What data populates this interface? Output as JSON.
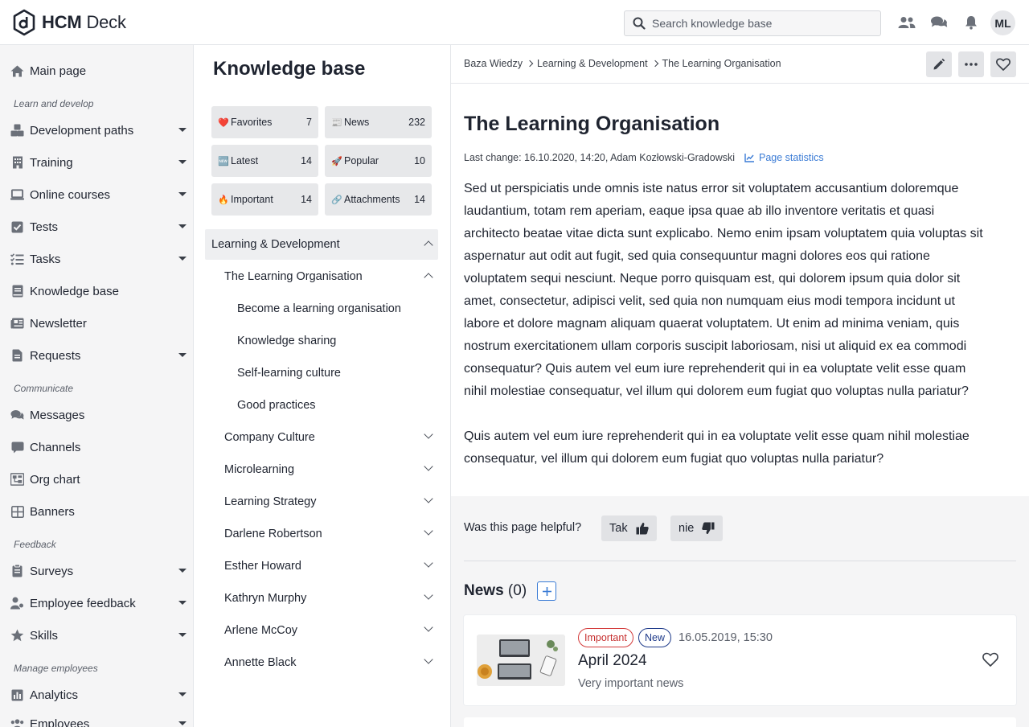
{
  "app": {
    "brand_bold": "HCM",
    "brand_light": "Deck"
  },
  "header": {
    "search_placeholder": "Search knowledge base",
    "user_initials": "ML",
    "icons": [
      "users-icon",
      "chat-icon",
      "bell-icon"
    ]
  },
  "sidebar": {
    "items": [
      {
        "label": "Main page",
        "icon": "home-icon",
        "has_submenu": false
      },
      {
        "label": "Development paths",
        "icon": "cubes-icon",
        "has_submenu": true
      },
      {
        "label": "Training",
        "icon": "building-icon",
        "has_submenu": true
      },
      {
        "label": "Online courses",
        "icon": "laptop-icon",
        "has_submenu": true
      },
      {
        "label": "Tests",
        "icon": "check-square-icon",
        "has_submenu": true
      },
      {
        "label": "Tasks",
        "icon": "tasks-icon",
        "has_submenu": true
      },
      {
        "label": "Knowledge base",
        "icon": "book-icon",
        "has_submenu": false
      },
      {
        "label": "Newsletter",
        "icon": "newspaper-icon",
        "has_submenu": false
      },
      {
        "label": "Requests",
        "icon": "file-icon",
        "has_submenu": true
      },
      {
        "label": "Messages",
        "icon": "comments-icon",
        "has_submenu": false
      },
      {
        "label": "Channels",
        "icon": "comment-icon",
        "has_submenu": false
      },
      {
        "label": "Org chart",
        "icon": "org-chart-icon",
        "has_submenu": false
      },
      {
        "label": "Banners",
        "icon": "grid-icon",
        "has_submenu": false
      },
      {
        "label": "Surveys",
        "icon": "clipboard-icon",
        "has_submenu": true
      },
      {
        "label": "Employee feedback",
        "icon": "user-feedback-icon",
        "has_submenu": true
      },
      {
        "label": "Skills",
        "icon": "star-icon",
        "has_submenu": true
      },
      {
        "label": "Analytics",
        "icon": "chart-icon",
        "has_submenu": true
      },
      {
        "label": "Employees",
        "icon": "users-icon",
        "has_submenu": true
      }
    ],
    "sections": [
      "Learn and develop",
      "Communicate",
      "Feedback",
      "Manage employees"
    ]
  },
  "kb": {
    "title": "Knowledge base",
    "chips": [
      {
        "emoji": "❤️",
        "label": "Favorites",
        "count": "7"
      },
      {
        "emoji": "📰",
        "label": "News",
        "count": "232"
      },
      {
        "emoji": "🆕",
        "label": "Latest",
        "count": "14"
      },
      {
        "emoji": "🚀",
        "label": "Popular",
        "count": "10"
      },
      {
        "emoji": "🔥",
        "label": "Important",
        "count": "14"
      },
      {
        "emoji": "🔗",
        "label": "Attachments",
        "count": "14"
      }
    ],
    "tree": [
      {
        "label": "Learning & Development",
        "level": 0,
        "state": "expanded",
        "selected": true
      },
      {
        "label": "The Learning Organisation",
        "level": 1,
        "state": "expanded"
      },
      {
        "label": "Become a learning organisation",
        "level": 2,
        "state": "leaf"
      },
      {
        "label": "Knowledge sharing",
        "level": 2,
        "state": "leaf"
      },
      {
        "label": "Self-learning culture",
        "level": 2,
        "state": "leaf"
      },
      {
        "label": "Good practices",
        "level": 2,
        "state": "leaf"
      },
      {
        "label": "Company Culture",
        "level": 1,
        "state": "collapsed"
      },
      {
        "label": "Microlearning",
        "level": 1,
        "state": "collapsed"
      },
      {
        "label": "Learning Strategy",
        "level": 1,
        "state": "collapsed"
      },
      {
        "label": "Darlene Robertson",
        "level": 1,
        "state": "collapsed"
      },
      {
        "label": "Esther Howard",
        "level": 1,
        "state": "collapsed"
      },
      {
        "label": "Kathryn Murphy",
        "level": 1,
        "state": "collapsed"
      },
      {
        "label": "Arlene McCoy",
        "level": 1,
        "state": "collapsed"
      },
      {
        "label": "Annette Black",
        "level": 1,
        "state": "collapsed"
      }
    ]
  },
  "page": {
    "breadcrumb": [
      "Baza Wiedzy",
      "Learning & Development",
      "The Learning Organisation"
    ],
    "title": "The Learning Organisation",
    "last_change": "Last change: 16.10.2020, 14:20, Adam Kozłowski-Gradowski",
    "stats_link": "Page statistics",
    "paragraphs": [
      "Sed ut perspiciatis unde omnis iste natus error sit voluptatem accusantium doloremque laudantium, totam rem aperiam, eaque ipsa quae ab illo inventore veritatis et quasi architecto beatae vitae dicta sunt explicabo. Nemo enim ipsam voluptatem quia voluptas sit aspernatur aut odit aut fugit, sed quia consequuntur magni dolores eos qui ratione voluptatem sequi nesciunt. Neque porro quisquam est, qui dolorem ipsum quia dolor sit amet, consectetur, adipisci velit, sed quia non numquam eius modi tempora incidunt ut labore et dolore magnam aliquam quaerat voluptatem. Ut enim ad minima veniam, quis nostrum exercitationem ullam corporis suscipit laboriosam, nisi ut aliquid ex ea commodi consequatur? Quis autem vel eum iure reprehenderit qui in ea voluptate velit esse quam nihil molestiae consequatur, vel illum qui dolorem eum fugiat quo voluptas nulla pariatur?",
      "Quis autem vel eum iure reprehenderit qui in ea voluptate velit esse quam nihil molestiae consequatur, vel illum qui dolorem eum fugiat quo voluptas nulla pariatur?"
    ],
    "helpful_question": "Was this page helpful?",
    "vote_yes": "Tak",
    "vote_no": "nie",
    "news_heading": "News",
    "news_count": "(0)",
    "news": [
      {
        "badges": [
          "Important",
          "New"
        ],
        "date": "16.05.2019, 15:30",
        "title": "April 2024",
        "description": "Very important news"
      }
    ]
  },
  "colors": {
    "accent": "#3a7bd5",
    "important": "#d33b3b",
    "new": "#1e3a8a"
  }
}
